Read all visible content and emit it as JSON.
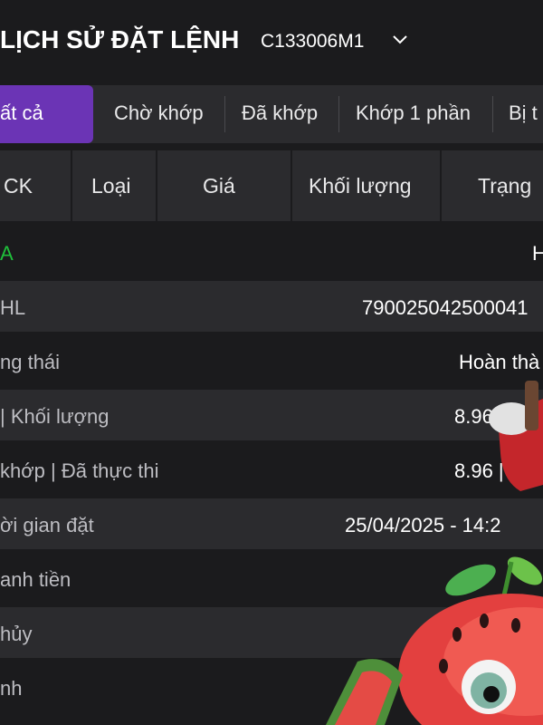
{
  "header": {
    "title": "LỊCH SỬ ĐẶT LỆNH",
    "account": "C133006M1"
  },
  "filters": [
    {
      "label": "ất cả",
      "active": true
    },
    {
      "label": "Chờ khớp",
      "active": false
    },
    {
      "label": "Đã khớp",
      "active": false
    },
    {
      "label": "Khớp 1 phần",
      "active": false
    },
    {
      "label": "Bị t",
      "active": false
    }
  ],
  "columns": [
    "CK",
    "Loại",
    "Giá",
    "Khối lượng",
    "Trạng"
  ],
  "details": [
    {
      "label": "A",
      "value": "H"
    },
    {
      "label": "HL",
      "value": "790025042500041"
    },
    {
      "label": "ng thái",
      "value": "Hoàn thà"
    },
    {
      "label": "| Khối lượng",
      "value": "8.96 | 2"
    },
    {
      "label": "khớp | Đã thực thi",
      "value": "8.96 |"
    },
    {
      "label": "ời gian đặt",
      "value": "25/04/2025 - 14:2"
    },
    {
      "label": "anh tiền",
      "value": ""
    },
    {
      "label": "hủy",
      "value": ""
    },
    {
      "label": "nh",
      "value": ""
    }
  ],
  "icons": {
    "account_dropdown": "chevron-down-icon",
    "mascot": "watermelon-mascot"
  },
  "colors": {
    "background": "#1b1b1d",
    "panel": "#2b2b2e",
    "active_tab": "#6b34b5",
    "accent_green": "#1fbf3b"
  }
}
